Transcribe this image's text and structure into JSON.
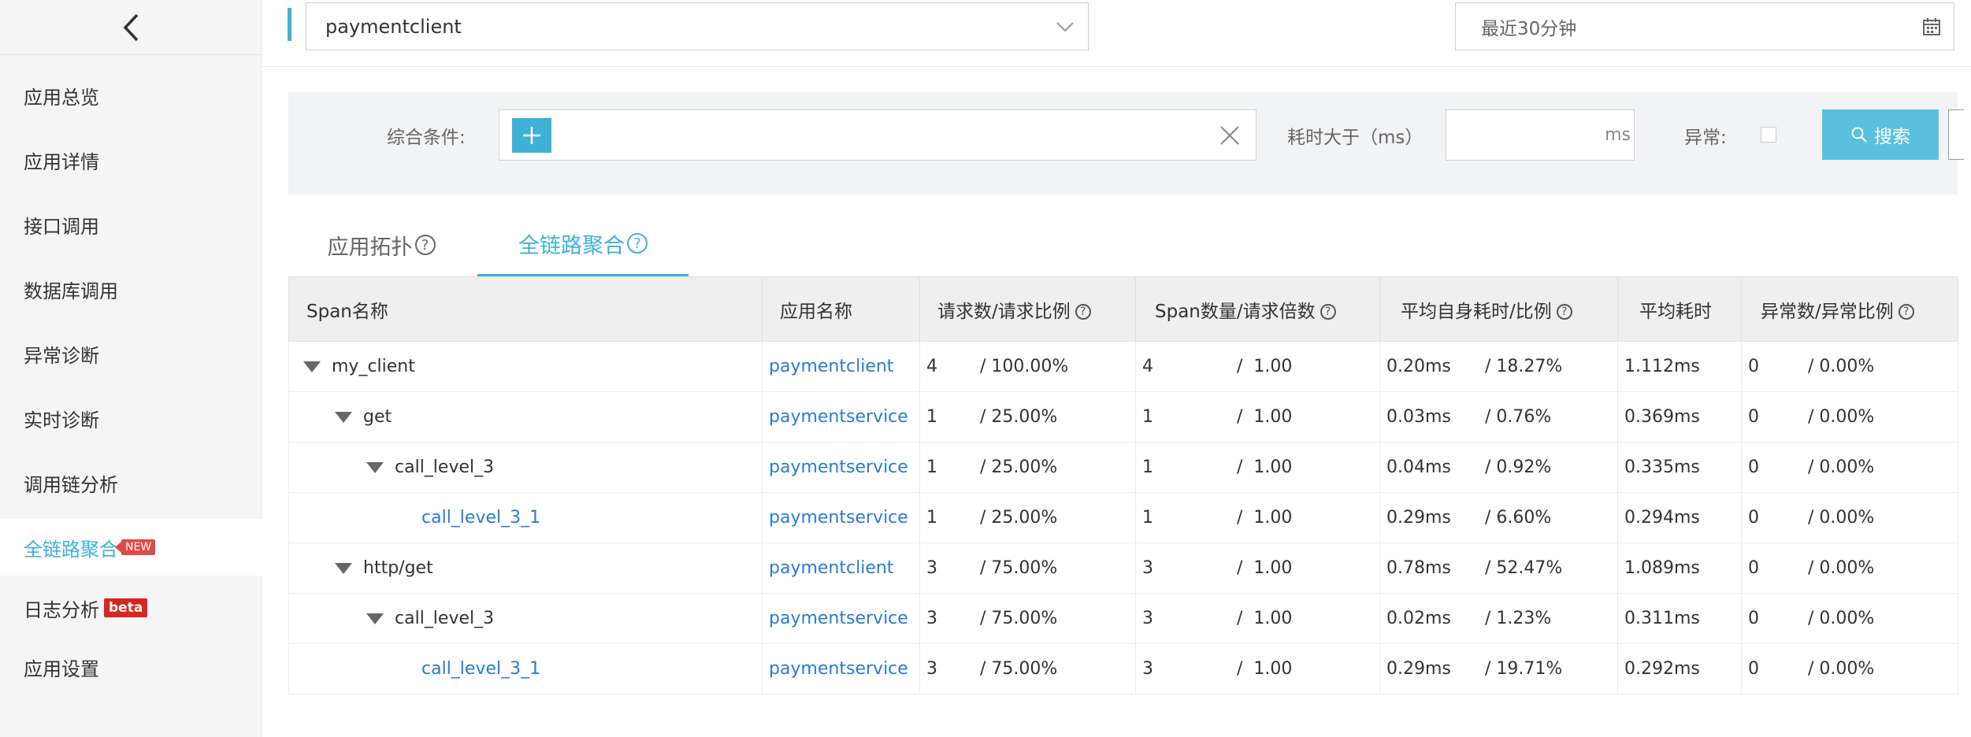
{
  "sidebar": {
    "items": [
      {
        "label": "应用总览"
      },
      {
        "label": "应用详情"
      },
      {
        "label": "接口调用"
      },
      {
        "label": "数据库调用"
      },
      {
        "label": "异常诊断"
      },
      {
        "label": "实时诊断"
      },
      {
        "label": "调用链分析"
      },
      {
        "label": "全链路聚合",
        "badge": "NEW",
        "active": true
      },
      {
        "label": "日志分析",
        "badge": "beta"
      },
      {
        "label": "应用设置"
      }
    ]
  },
  "topbar": {
    "app_value": "paymentclient",
    "time_range": "最近30分钟"
  },
  "filter": {
    "condition_label": "综合条件:",
    "duration_label": "耗时大于（ms）",
    "duration_unit": "ms",
    "error_label": "异常:",
    "search_label": "搜索"
  },
  "tabs": [
    {
      "label": "应用拓扑"
    },
    {
      "label": "全链路聚合",
      "active": true
    }
  ],
  "table": {
    "headers": [
      "Span名称",
      "应用名称",
      "请求数/请求比例",
      "Span数量/请求倍数",
      "平均自身耗时/比例",
      "平均耗时",
      "异常数/异常比例"
    ],
    "rows": [
      {
        "span": "my_client",
        "app": "paymentclient",
        "req": "4",
        "req_ratio": "/ 100.00%",
        "span_count": "4",
        "span_mult": "/  1.00",
        "self_time": "0.20ms",
        "self_ratio": "/ 18.27%",
        "avg": "1.112ms",
        "err": "0",
        "err_ratio": "/ 0.00%"
      },
      {
        "span": "get",
        "app": "paymentservice",
        "req": "1",
        "req_ratio": "/ 25.00%",
        "span_count": "1",
        "span_mult": "/  1.00",
        "self_time": "0.03ms",
        "self_ratio": "/ 0.76%",
        "avg": "0.369ms",
        "err": "0",
        "err_ratio": "/ 0.00%"
      },
      {
        "span": "call_level_3",
        "app": "paymentservice",
        "req": "1",
        "req_ratio": "/ 25.00%",
        "span_count": "1",
        "span_mult": "/  1.00",
        "self_time": "0.04ms",
        "self_ratio": "/ 0.92%",
        "avg": "0.335ms",
        "err": "0",
        "err_ratio": "/ 0.00%"
      },
      {
        "span": "call_level_3_1",
        "app": "paymentservice",
        "req": "1",
        "req_ratio": "/ 25.00%",
        "span_count": "1",
        "span_mult": "/  1.00",
        "self_time": "0.29ms",
        "self_ratio": "/ 6.60%",
        "avg": "0.294ms",
        "err": "0",
        "err_ratio": "/ 0.00%"
      },
      {
        "span": "http/get",
        "app": "paymentclient",
        "req": "3",
        "req_ratio": "/ 75.00%",
        "span_count": "3",
        "span_mult": "/  1.00",
        "self_time": "0.78ms",
        "self_ratio": "/ 52.47%",
        "avg": "1.089ms",
        "err": "0",
        "err_ratio": "/ 0.00%"
      },
      {
        "span": "call_level_3",
        "app": "paymentservice",
        "req": "3",
        "req_ratio": "/ 75.00%",
        "span_count": "3",
        "span_mult": "/  1.00",
        "self_time": "0.02ms",
        "self_ratio": "/ 1.23%",
        "avg": "0.311ms",
        "err": "0",
        "err_ratio": "/ 0.00%"
      },
      {
        "span": "call_level_3_1",
        "app": "paymentservice",
        "req": "3",
        "req_ratio": "/ 75.00%",
        "span_count": "3",
        "span_mult": "/  1.00",
        "self_time": "0.29ms",
        "self_ratio": "/ 19.71%",
        "avg": "0.292ms",
        "err": "0",
        "err_ratio": "/ 0.00%"
      }
    ]
  },
  "colors": {
    "accent": "#3fb1d8",
    "link": "#2a7bd3",
    "badge_red": "#e34848"
  }
}
